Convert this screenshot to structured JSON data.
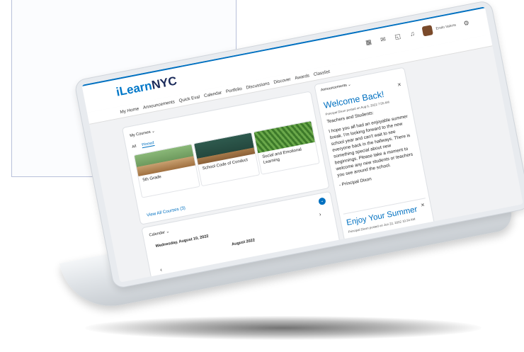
{
  "app": {
    "brand_prefix": "iLearn",
    "brand_suffix": "NYC",
    "user_name": "Emilo Valens"
  },
  "nav": [
    "My Home",
    "Announcements",
    "Quick Eval",
    "Calendar",
    "Portfolio",
    "Discussions",
    "Discover",
    "Awards",
    "Classlist"
  ],
  "courses_widget": {
    "title": "My Courses",
    "tabs": [
      "All",
      "Pinned"
    ],
    "selected_tab": "Pinned",
    "courses": [
      {
        "name": "5th Grade",
        "image_color": "#7aa86a"
      },
      {
        "name": "School Code of Conduct",
        "image_color": "#2e5a4e"
      },
      {
        "name": "Social and Emotional Learning",
        "image_color": "#3d7a2a"
      }
    ],
    "view_all": "View All Courses (3)"
  },
  "announcements": {
    "header": "Announcements",
    "items": [
      {
        "title": "Welcome Back!",
        "meta": "Principal Dixon posted on Aug 6, 2022 7:55 AM",
        "body": [
          "Teachers and Students:",
          "I hope you all had an enjoyable summer break. I'm looking forward to the new school year and can't wait to see everyone back in the hallways. There is something special about new beginnings. Please take a moment to welcome any new students or teachers you see around the school.",
          "- Principal Dixon"
        ]
      },
      {
        "title": "Enjoy Your Summer",
        "meta": "Principal Dixon posted on Jun 22, 2022 10:34 AM"
      }
    ]
  },
  "calendar": {
    "title": "Calendar",
    "selected_date": "Wednesday, August 10, 2022",
    "month": "August 2022"
  },
  "colors": {
    "accent": "#0070c0",
    "brand_dark": "#1a2a5a"
  },
  "icons": {
    "close": "×",
    "chevron_down": "⌄",
    "chevron_right": "›",
    "chevron_left": "‹"
  }
}
